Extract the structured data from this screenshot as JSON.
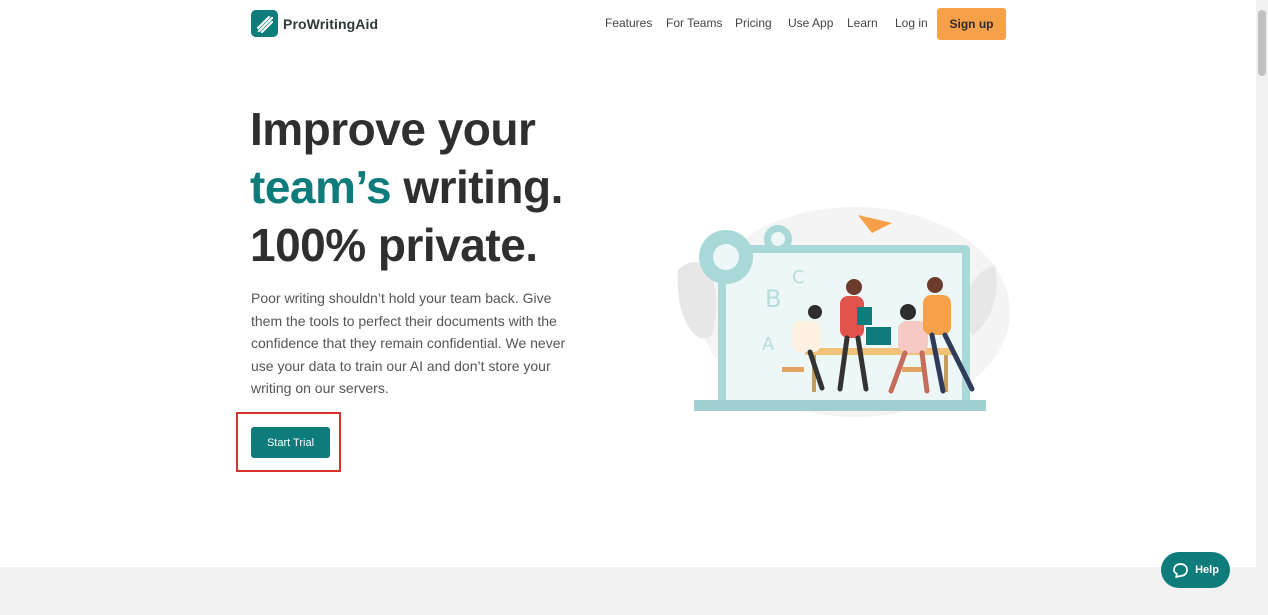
{
  "brand": {
    "name": "ProWritingAid",
    "logo_icon": "feather-icon"
  },
  "nav": {
    "items": [
      {
        "label": "Features"
      },
      {
        "label": "For Teams"
      },
      {
        "label": "Pricing"
      },
      {
        "label": "Use App"
      },
      {
        "label": "Learn"
      },
      {
        "label": "Log in"
      }
    ],
    "signup": "Sign up"
  },
  "hero": {
    "line1": "Improve your",
    "accent": "team’s",
    "line2_rest": " writing.",
    "line3": "100% private.",
    "description": "Poor writing shouldn’t hold your team back. Give them the tools to perfect their documents with the confidence that they remain confidential. We never use your data to train our AI and don’t store your writing on our servers.",
    "cta": "Start Trial"
  },
  "help": {
    "label": "Help",
    "icon": "chat-bubble-icon"
  },
  "colors": {
    "brand": "#0e7c7b",
    "signup": "#f6a14a",
    "highlight": "#d83131"
  }
}
